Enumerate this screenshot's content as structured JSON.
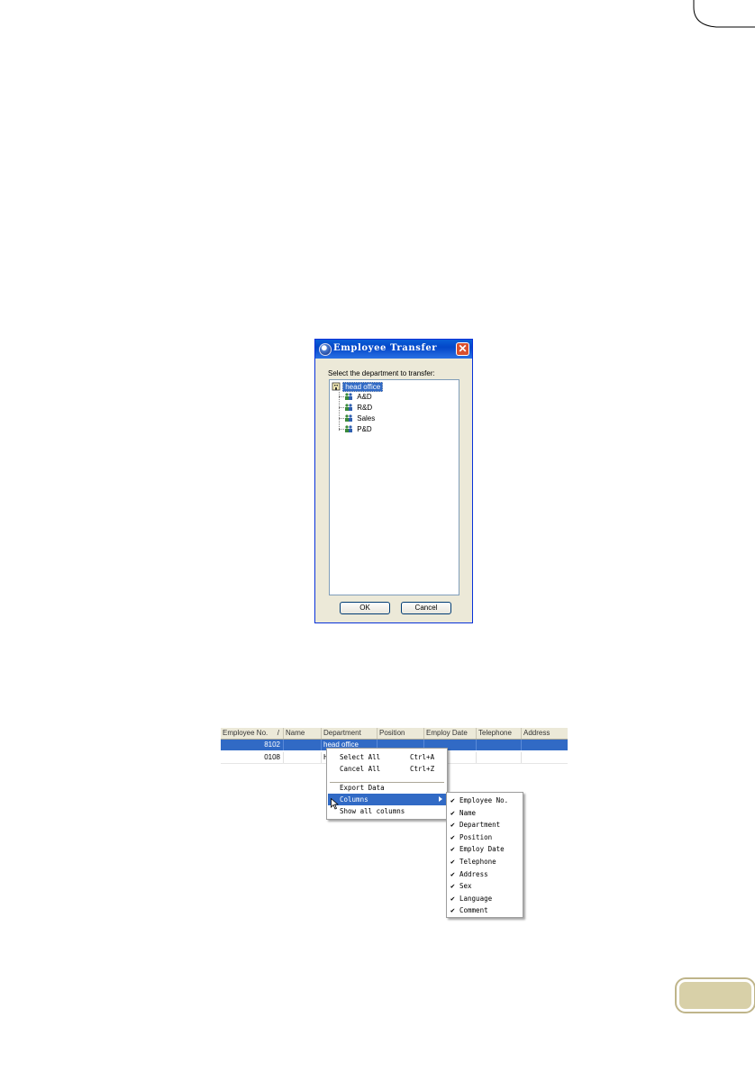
{
  "dialog": {
    "title": "Employee Transfer",
    "close_glyph": "✕",
    "prompt": "Select the department to transfer:",
    "tree": {
      "root": "head office",
      "children": [
        "A&D",
        "R&D",
        "Sales",
        "P&D"
      ]
    },
    "ok_label": "OK",
    "cancel_label": "Cancel"
  },
  "grid": {
    "columns": [
      "Employee No.",
      "Name",
      "Department",
      "Position",
      "Employ Date",
      "Telephone",
      "Address"
    ],
    "sort_indicator": "/",
    "rows": [
      {
        "employee_no": "8102",
        "name": "",
        "department": "head office"
      },
      {
        "employee_no": "0108",
        "name": "",
        "department": "H"
      }
    ]
  },
  "context_menu": {
    "items": [
      {
        "label": "Select All",
        "shortcut": "Ctrl+A"
      },
      {
        "label": "Cancel All",
        "shortcut": "Ctrl+Z"
      },
      {
        "label": "Export Data",
        "shortcut": ""
      },
      {
        "label": "Columns",
        "shortcut": ""
      },
      {
        "label": "Show all columns",
        "shortcut": ""
      }
    ]
  },
  "columns_submenu": {
    "check_glyph": "✔",
    "items": [
      "Employee No.",
      "Name",
      "Department",
      "Position",
      "Employ Date",
      "Telephone",
      "Address",
      "Sex",
      "Language",
      "Comment"
    ]
  },
  "colors": {
    "selection": "#316ac5",
    "title_bar": "#0a5fd8",
    "page_tab": "#d8d0a8"
  }
}
